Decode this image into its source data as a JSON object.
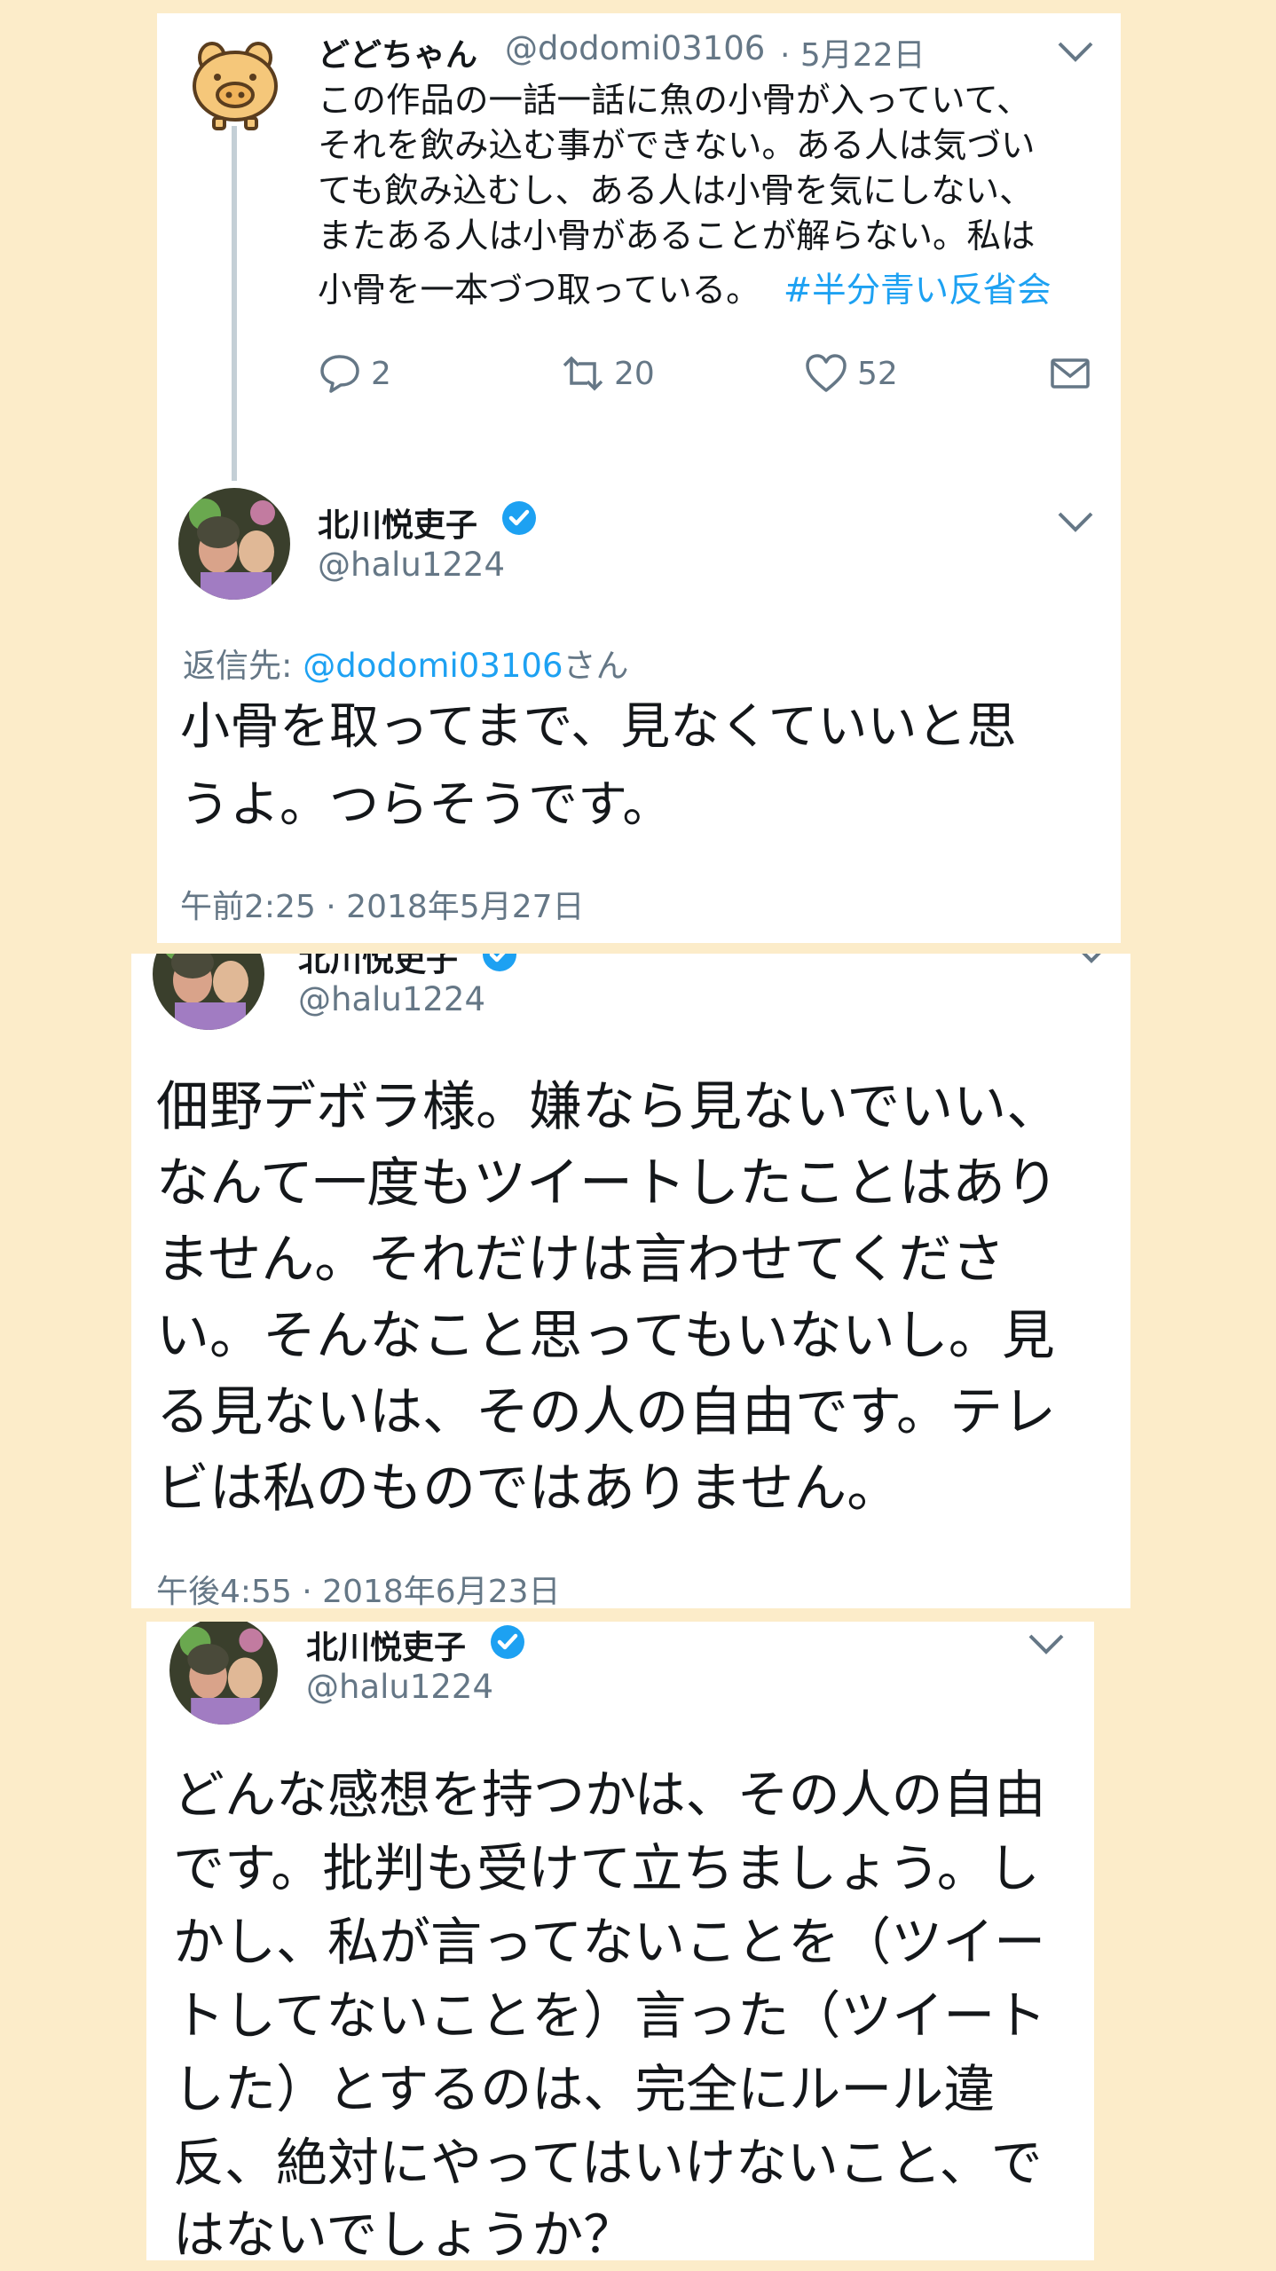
{
  "tweet1": {
    "display_name": "どどちゃん",
    "handle": "@dodomi03106",
    "date": "· 5月22日",
    "lines": [
      "この作品の一話一話に魚の小骨が入っていて、",
      "それを飲み込む事ができない。ある人は気づい",
      "ても飲み込むし、ある人は小骨を気にしない、",
      "またある人は小骨があることが解らない。私は",
      "小骨を一本づつ取っている。"
    ],
    "hashtag": "#半分青い反省会",
    "actions": {
      "replies": "2",
      "retweets": "20",
      "likes": "52"
    }
  },
  "tweet2": {
    "display_name": "北川悦吏子",
    "handle": "@halu1224",
    "reply_label": "返信先: ",
    "reply_mention": "@dodomi03106",
    "reply_suffix": "さん",
    "lines": [
      "小骨を取ってまで、見なくていいと思",
      "うよ。つらそうです。"
    ],
    "timestamp": "午前2:25 · 2018年5月27日"
  },
  "tweet3": {
    "display_name": "北川悦吏子",
    "handle": "@halu1224",
    "lines": [
      "佃野デボラ様。嫌なら見ないでいい、",
      "なんて一度もツイートしたことはあり",
      "ません。それだけは言わせてくださ",
      "い。そんなこと思ってもいないし。見",
      "る見ないは、その人の自由です。テレ",
      "ビは私のものではありません。"
    ],
    "timestamp": "午後4:55 · 2018年6月23日"
  },
  "tweet4": {
    "display_name": "北川悦吏子",
    "handle": "@halu1224",
    "lines": [
      "どんな感想を持つかは、その人の自由",
      "です。批判も受けて立ちましょう。し",
      "かし、私が言ってないことを（ツイー",
      "トしてないことを）言った（ツイート",
      "した）とするのは、完全にルール違",
      "反、絶対にやってはいけないこと、で",
      "はないでしょうか？"
    ]
  },
  "colors": {
    "background": "#fcecc9",
    "link": "#1da1f2",
    "secondary_text": "#657786",
    "verified": "#1da1f2"
  },
  "icons": [
    "pig-avatar-icon",
    "reply-icon",
    "retweet-icon",
    "like-icon",
    "dm-icon",
    "chevron-down-icon",
    "verified-badge-icon"
  ]
}
